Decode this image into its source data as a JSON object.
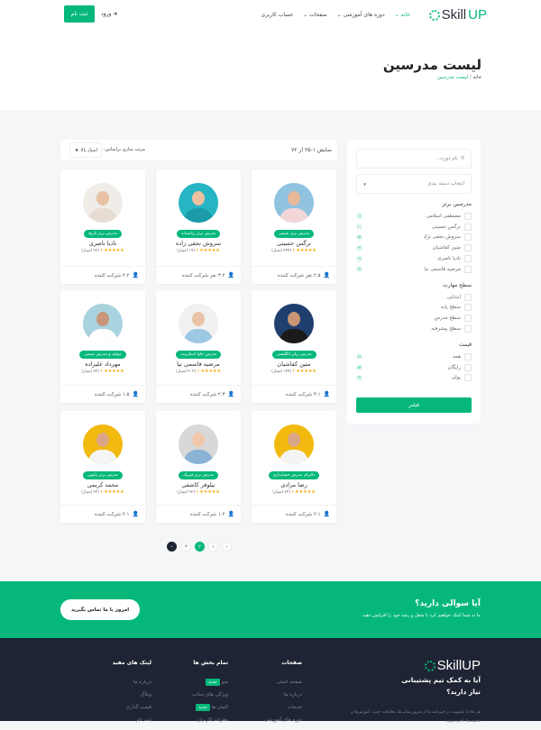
{
  "header": {
    "logo": "SkillUP",
    "logo_a": "Skill",
    "logo_b": "UP",
    "nav": [
      "خانه",
      "دوره های آموزشی",
      "صفحات",
      "حساب کاربری"
    ],
    "login": "ورود",
    "signup": "ثبت نام"
  },
  "hero": {
    "title": "لیست مدرسین",
    "crumb_home": "خانه",
    "crumb_sep": "/",
    "crumb_current": "لیست مدرسین"
  },
  "sidebar": {
    "search_placeholder": "نام دوره...",
    "category_select": "انتخاب دسته بندی",
    "top_title": "مدرسین برتر",
    "top": [
      {
        "label": "مصطفی اسلامی",
        "count": "۱۲"
      },
      {
        "label": "نرگس حسینی",
        "count": "۱۰"
      },
      {
        "label": "سروش نجفی نژاد",
        "count": "۵۴"
      },
      {
        "label": "متین کفاشیان",
        "count": "۳۲"
      },
      {
        "label": "نادیا ناصری",
        "count": "۱۲"
      },
      {
        "label": "مرضیه قاسمی نیا",
        "count": "۳۲"
      }
    ],
    "level_title": "سطح مهارت",
    "levels": [
      "ابتدایی",
      "سطح پایه",
      "سطح مدرس",
      "سطح پیشرفته"
    ],
    "price_title": "قیمت",
    "prices": [
      {
        "label": "همه",
        "count": "۷۶"
      },
      {
        "label": "رایگان",
        "count": "۵۴"
      },
      {
        "label": "پولی",
        "count": "۳۲"
      }
    ],
    "filter_button": "فیلتر"
  },
  "toolbar": {
    "showing": "نمایش ۱-۲۵ از ۷۲",
    "sort_label": "مرتب سازی براساس:",
    "sort_value": "امتیاز بالا"
  },
  "teachers": [
    {
      "name": "نرگس حسینی",
      "badge": "مدرس برتر شیمی",
      "score": "۴",
      "votes": "(۲۴۴ امتیاز)",
      "students": "۲.۵ نفر شرکت کننده",
      "bg": "#8fc3e0",
      "skin": "#e8b89a",
      "shirt": "#f2d6d8"
    },
    {
      "name": "سروش نجفی زاده",
      "badge": "مدرس برتر ریاضیات",
      "score": "۴",
      "votes": "(۱۹ امتیاز)",
      "students": "۳.۲ نفر شرکت کننده",
      "bg": "#27b5c4",
      "skin": "#eec0a2",
      "shirt": "#1b9aa8"
    },
    {
      "name": "نادیا ناصری",
      "badge": "مدرس برتر تاریخ",
      "score": "۴",
      "votes": "(۹۷ امتیاز)",
      "students": "۲.۲ شرکت کننده",
      "bg": "#f0ece8",
      "skin": "#e9c1a5",
      "shirt": "#e6dcd2"
    },
    {
      "name": "متین کفاشیان",
      "badge": "مدرس زبان انگلیسی",
      "score": "۴",
      "votes": "(۱۴۹ امتیاز)",
      "students": "۳.۱ شرکت کننده",
      "bg": "#1f3f6e",
      "skin": "#c99574",
      "shirt": "#1a1a1a"
    },
    {
      "name": "مرضیه قاسمی نیا",
      "badge": "مدرس جاوا اسکریپت",
      "score": "۴",
      "votes": "(۲۰۴ امتیاز)",
      "students": "۲.۳ شرکت کننده",
      "bg": "#f1f1f1",
      "skin": "#eac3a6",
      "shirt": "#9cc8e4"
    },
    {
      "name": "مهرداد علیزاده",
      "badge": "مولف و مدرس شیمی",
      "score": "۴",
      "votes": "(۷۴ امتیاز)",
      "students": "۱.۵ شرکت کننده",
      "bg": "#a9d3de",
      "skin": "#c9967a",
      "shirt": "#ffffff"
    },
    {
      "name": "رضا مرادی",
      "badge": "دکترای مدرس حسابداری",
      "score": "۴",
      "votes": "(۷۳ امتیاز)",
      "students": "۲.۱ شرکت کننده",
      "bg": "#f2b90f",
      "skin": "#d9a584",
      "shirt": "#f4f4f4"
    },
    {
      "name": "نیلوفر کاشفی",
      "badge": "مدرس برتر فیزیک",
      "score": "۴",
      "votes": "(۹۶ امتیاز)",
      "students": "۱.۲ شرکت کننده",
      "bg": "#d8d8d8",
      "skin": "#efc7aa",
      "shirt": "#8bb3d6"
    },
    {
      "name": "محمد کریمی",
      "badge": "مدرس برتر پایتون",
      "score": "۴",
      "votes": "(۷۳ امتیاز)",
      "students": "۲.۱ شرکت کننده",
      "bg": "#f2b90f",
      "skin": "#d9a584",
      "shirt": "#f4f4f4"
    }
  ],
  "stars": "★★★★★",
  "pagination": {
    "pages": [
      "۱",
      "۲",
      "۳"
    ],
    "active": "۲"
  },
  "cta": {
    "title": "آیا سوالی دارید؟",
    "text": "ما به شما کمک خواهیم کرد تا شغل و رشد خود را افزایش دهید.",
    "button": "امروز با ما تماس بگیرید"
  },
  "footer": {
    "title_line1": "آیا به کمک تیم پشتیبانی",
    "title_line2": "نیاز دارید؟",
    "text": "هر ماه با عضویت در خبرنامه ما از به‌روزرسانی‌ها، معاملات جدید، آموزش‌ها و تخفیف‌ها باخبر شوید.",
    "cols": [
      {
        "title": "صفحات",
        "items": [
          "صفحه اصلی",
          "درباره ما",
          "خدمات",
          "دوره های آموزشی"
        ]
      },
      {
        "title": "تمام بخش ها",
        "items": [
          "منو",
          "ویژگی های جذاب",
          "المان ها",
          "نظرات کاربران"
        ]
      },
      {
        "title": "لینک های مفید",
        "items": [
          "درباره ما",
          "وبلاگ",
          "قیمت گذاری",
          "ثبت نام"
        ]
      }
    ],
    "new_tag": "جدید"
  },
  "colors": {
    "accent": "#05b87a",
    "footer_bg": "#1e2433",
    "page_bg": "#f5f6f8"
  }
}
